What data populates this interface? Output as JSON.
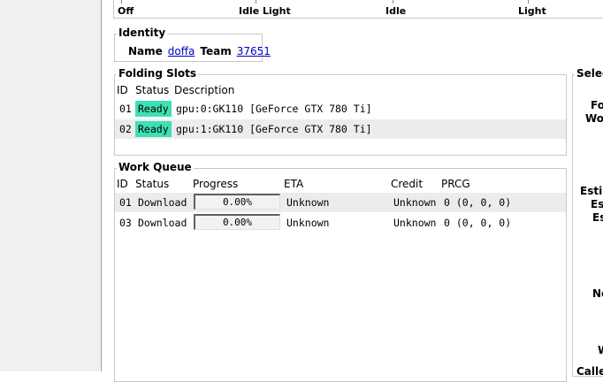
{
  "slider": {
    "ticks": [
      "Off",
      "Idle Light",
      "Idle",
      "Light"
    ]
  },
  "identity": {
    "legend": "Identity",
    "name_label": "Name",
    "name_value": "doffa",
    "team_label": "Team",
    "team_value": "37651"
  },
  "folding_slots": {
    "legend": "Folding Slots",
    "headers": [
      "ID",
      "Status",
      "Description"
    ],
    "rows": [
      {
        "id": "01",
        "status": "Ready",
        "description": "gpu:0:GK110 [GeForce GTX 780 Ti]"
      },
      {
        "id": "02",
        "status": "Ready",
        "description": "gpu:1:GK110 [GeForce GTX 780 Ti]"
      }
    ],
    "status_color": "#3de0b4"
  },
  "work_queue": {
    "legend": "Work Queue",
    "headers": [
      "ID",
      "Status",
      "Progress",
      "ETA",
      "Credit",
      "PRCG"
    ],
    "rows": [
      {
        "id": "01",
        "status": "Download",
        "progress": "0.00%",
        "eta": "Unknown",
        "credit": "Unknown",
        "prcg": "0 (0, 0, 0)"
      },
      {
        "id": "03",
        "status": "Download",
        "progress": "0.00%",
        "eta": "Unknown",
        "credit": "Unknown",
        "prcg": "0 (0, 0, 0)"
      }
    ]
  },
  "right_panel": {
    "legend": "Selec",
    "labels": [
      "Fo",
      "Wo",
      "Estin",
      "Est",
      "Es",
      "Ne",
      "W",
      "Calle"
    ]
  }
}
